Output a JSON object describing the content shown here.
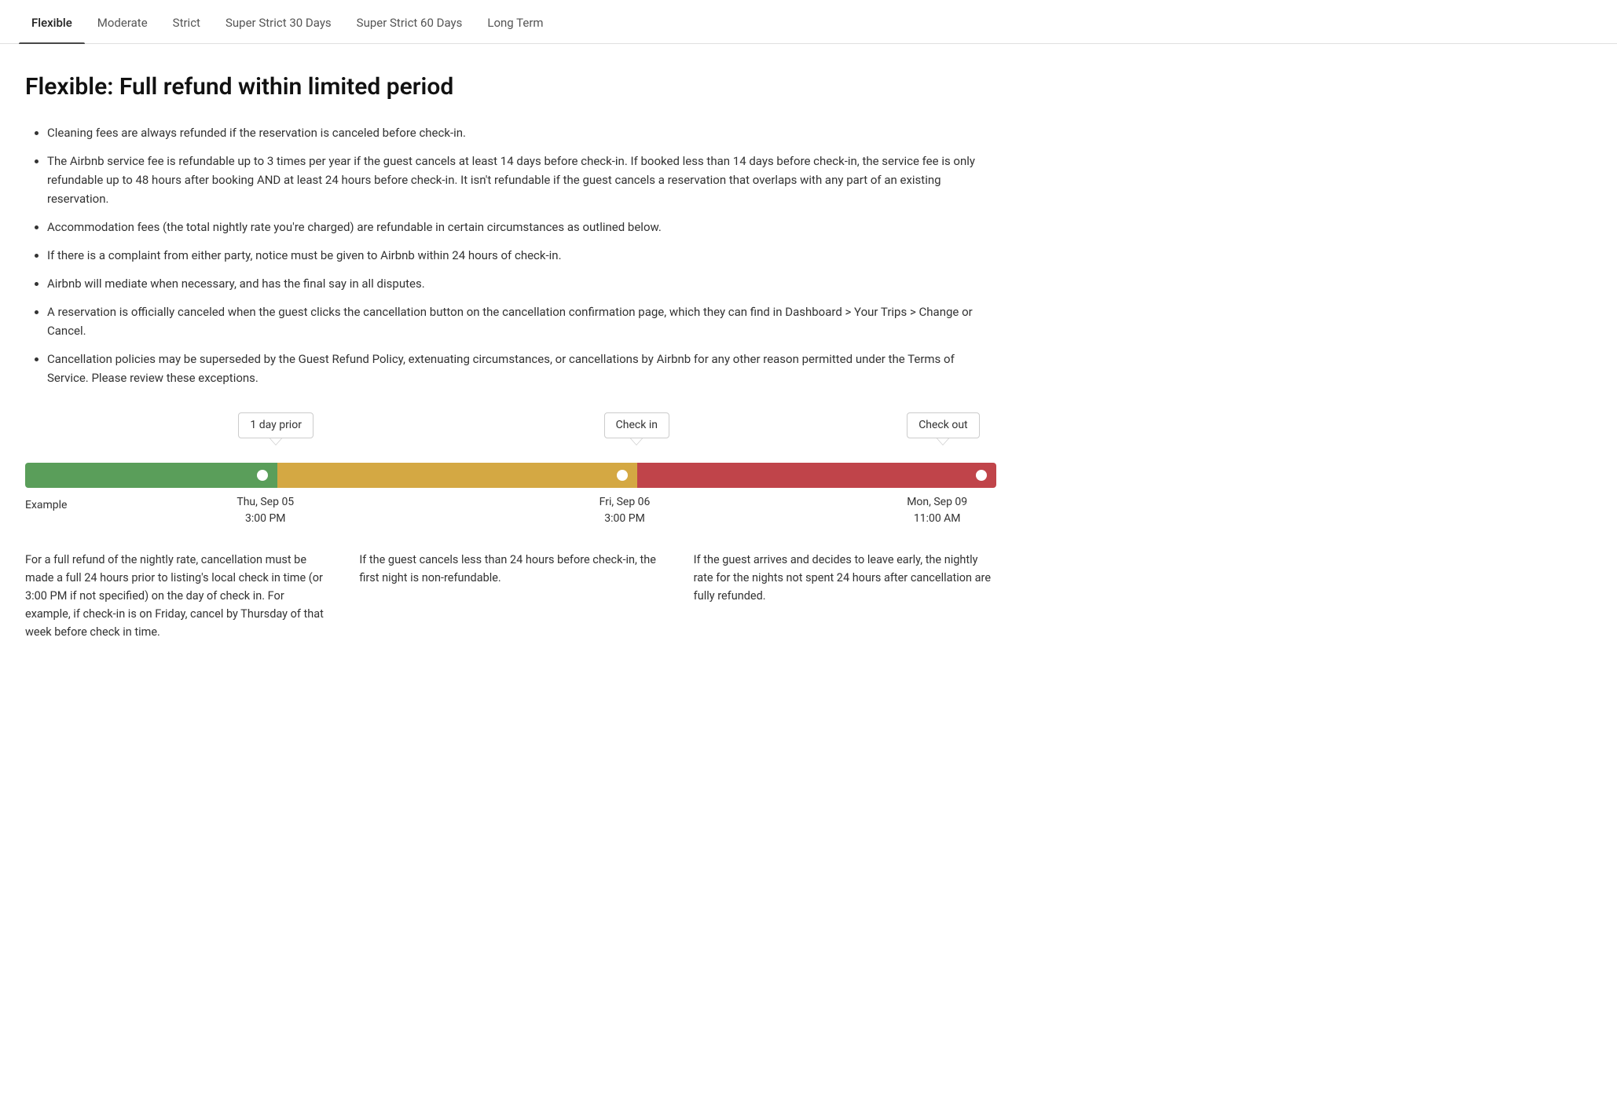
{
  "tabs": [
    {
      "id": "flexible",
      "label": "Flexible",
      "active": true
    },
    {
      "id": "moderate",
      "label": "Moderate",
      "active": false
    },
    {
      "id": "strict",
      "label": "Strict",
      "active": false
    },
    {
      "id": "super-strict-30",
      "label": "Super Strict 30 Days",
      "active": false
    },
    {
      "id": "super-strict-60",
      "label": "Super Strict 60 Days",
      "active": false
    },
    {
      "id": "long-term",
      "label": "Long Term",
      "active": false
    }
  ],
  "page_title": "Flexible: Full refund within limited period",
  "bullets": [
    "Cleaning fees are always refunded if the reservation is canceled before check-in.",
    "The Airbnb service fee is refundable up to 3 times per year if the guest cancels at least 14 days before check-in. If booked less than 14 days before check-in, the service fee is only refundable up to 48 hours after booking AND at least 24 hours before check-in. It isn't refundable if the guest cancels a reservation that overlaps with any part of an existing reservation.",
    "Accommodation fees (the total nightly rate you're charged) are refundable in certain circumstances as outlined below.",
    "If there is a complaint from either party, notice must be given to Airbnb within 24 hours of check-in.",
    "Airbnb will mediate when necessary, and has the final say in all disputes.",
    "A reservation is officially canceled when the guest clicks the cancellation button on the cancellation confirmation page, which they can find in Dashboard > Your Trips > Change or Cancel.",
    "Cancellation policies may be superseded by the Guest Refund Policy, extenuating circumstances, or cancellations by Airbnb for any other reason permitted under the Terms of Service. Please review these exceptions."
  ],
  "timeline": {
    "label_1_prior": "1 day prior",
    "label_2_checkin": "Check in",
    "label_3_checkout": "Check out",
    "example_label": "Example",
    "date_1": "Thu, Sep 05",
    "time_1": "3:00 PM",
    "date_2": "Fri, Sep 06",
    "time_2": "3:00 PM",
    "date_3": "Mon, Sep 09",
    "time_3": "11:00 AM"
  },
  "descriptions": {
    "col1": "For a full refund of the nightly rate, cancellation must be made a full 24 hours prior to listing's local check in time (or 3:00 PM if not specified) on the day of check in. For example, if check-in is on Friday, cancel by Thursday of that week before check in time.",
    "col2": "If the guest cancels less than 24 hours before check-in, the first night is non-refundable.",
    "col3": "If the guest arrives and decides to leave early, the nightly rate for the nights not spent 24 hours after cancellation are fully refunded."
  }
}
